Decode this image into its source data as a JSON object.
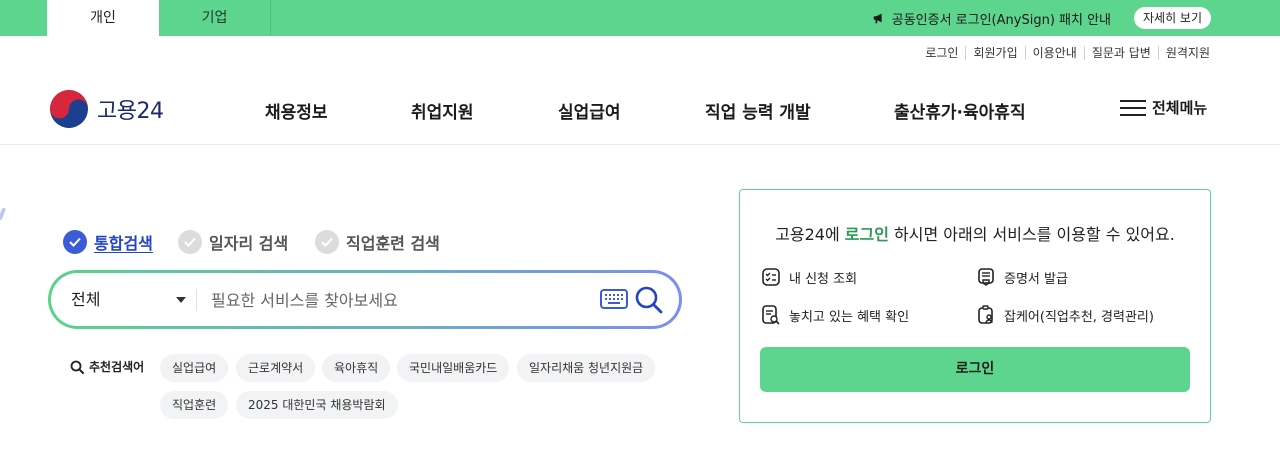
{
  "topbar": {
    "tabs": [
      "개인",
      "기업"
    ],
    "notice": "공동인증서 로그인(AnySign) 패치 안내",
    "more": "자세히 보기"
  },
  "util_links": [
    "로그인",
    "회원가입",
    "이용안내",
    "질문과 답변",
    "원격지원"
  ],
  "header": {
    "logo_text": "고용24",
    "nav": [
      "채용정보",
      "취업지원",
      "실업급여",
      "직업 능력 개발",
      "출산휴가·육아휴직"
    ],
    "all_menu": "전체메뉴"
  },
  "search": {
    "tabs": [
      "통합검색",
      "일자리 검색",
      "직업훈련 검색"
    ],
    "active_tab": "통합검색",
    "scope": "전체",
    "placeholder": "필요한 서비스를 찾아보세요",
    "recommended_label": "추천검색어",
    "recommended": [
      "실업급여",
      "근로계약서",
      "육아휴직",
      "국민내일배움카드",
      "일자리채움 청년지원금",
      "직업훈련",
      "2025 대한민국 채용박람회"
    ]
  },
  "login_panel": {
    "title_prefix": "고용24에 ",
    "title_highlight": "로그인",
    "title_suffix": " 하시면 아래의 서비스를 이용할 수 있어요.",
    "services": [
      "내 신청 조회",
      "증명서 발급",
      "놓치고 있는 혜택 확인",
      "잡케어(직업추천, 경력관리)"
    ],
    "button": "로그인"
  },
  "colors": {
    "brand_green": "#5dd58e",
    "accent_blue": "#3b5bd9",
    "highlight_green": "#2b9a54"
  }
}
